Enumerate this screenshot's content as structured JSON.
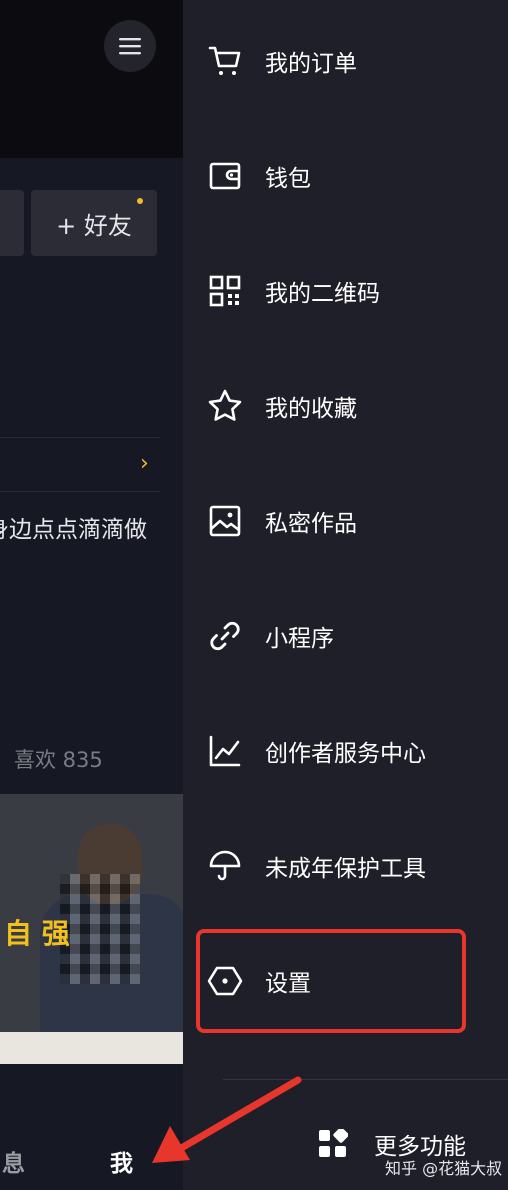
{
  "background": {
    "menu_icon": "hamburger-icon",
    "add_friend_label": "+ 好友",
    "bio_text": "身边点点滴滴做",
    "likes_label": "喜欢 835",
    "thumbnail_text": "自  强",
    "nav": {
      "messages_label": "息",
      "me_label": "我"
    }
  },
  "drawer": {
    "items": [
      {
        "label": "我的订单",
        "icon": "cart-icon"
      },
      {
        "label": "钱包",
        "icon": "wallet-icon"
      },
      {
        "label": "我的二维码",
        "icon": "qrcode-icon"
      },
      {
        "label": "我的收藏",
        "icon": "star-icon"
      },
      {
        "label": "私密作品",
        "icon": "image-icon"
      },
      {
        "label": "小程序",
        "icon": "link-icon"
      },
      {
        "label": "创作者服务中心",
        "icon": "chart-icon"
      },
      {
        "label": "未成年保护工具",
        "icon": "umbrella-icon"
      },
      {
        "label": "设置",
        "icon": "hexagon-icon"
      }
    ],
    "more_label": "更多功能",
    "more_icon": "grid-icon"
  },
  "watermark": "知乎 @花猫大叔",
  "colors": {
    "drawer_bg": "#1f1f29",
    "highlight": "#e8362d",
    "accent": "#f2b92c"
  }
}
